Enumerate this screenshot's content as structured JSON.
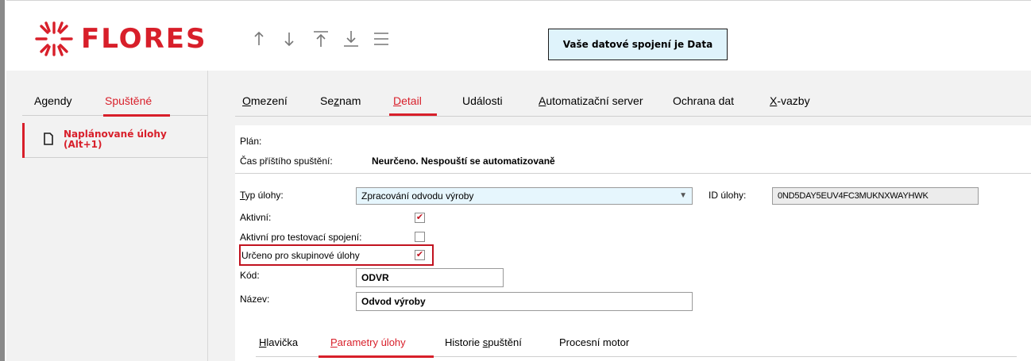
{
  "app": {
    "logo_text": "FLORES",
    "connection": "Vaše datové spojení je Data"
  },
  "toolbar": {
    "icons": [
      "arrow-up-icon",
      "arrow-down-icon",
      "arrow-top-icon",
      "arrow-bottom-icon",
      "menu-icon"
    ]
  },
  "sidebar": {
    "tabs": [
      {
        "label": "Agendy"
      },
      {
        "label": "Spuštěné"
      }
    ],
    "items": [
      {
        "line1": "Naplánované úlohy",
        "line2": "(Alt+1)"
      }
    ]
  },
  "main_tabs": {
    "items": [
      {
        "ul": "O",
        "rest": "mezení"
      },
      {
        "pre": "Se",
        "ul": "z",
        "rest": "nam"
      },
      {
        "ul": "D",
        "rest": "etail"
      },
      {
        "label": "Události"
      },
      {
        "ul": "A",
        "rest": "utomatizační server"
      },
      {
        "label": "Ochrana dat"
      },
      {
        "ul": "X",
        "rest": "-vazby"
      }
    ]
  },
  "detail": {
    "plan_label": "Plán:",
    "next_run_label": "Čas příštího spuštění:",
    "next_run_value": "Neurčeno. Nespouští se automatizovaně",
    "task_type_ul": "T",
    "task_type_rest": "yp úlohy:",
    "task_type_value": "Zpracování odvodu výroby",
    "task_id_label": "ID úlohy:",
    "task_id_value": "0ND5DAY5EUV4FC3MUKNXWAYHWK",
    "active_label": "Aktivní:",
    "active_checked": true,
    "active_test_label": "Aktivní pro testovací spojení:",
    "active_test_checked": false,
    "group_label": "Určeno pro skupinové úlohy",
    "group_checked": true,
    "code_label": "Kód:",
    "code_value": "ODVR",
    "name_label": "Název:",
    "name_value": "Odvod výroby"
  },
  "subtabs": {
    "items": [
      {
        "ul": "H",
        "rest": "lavička"
      },
      {
        "ul": "P",
        "rest": "arametry úlohy"
      },
      {
        "pre": "Historie ",
        "ul": "s",
        "rest": "puštění"
      },
      {
        "label": "Procesní motor"
      }
    ]
  },
  "colors": {
    "accent": "#d81f2a",
    "highlight": "#c1121f",
    "conn_bg": "#dff3fb"
  }
}
